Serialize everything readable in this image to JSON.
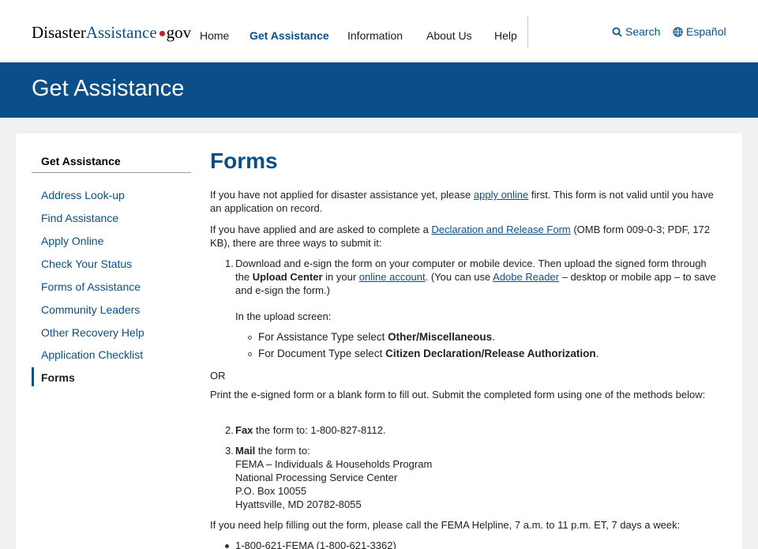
{
  "header": {
    "logo": {
      "part1": "Disaster",
      "part2": "Assistance",
      "part3": "gov"
    },
    "nav": [
      "Home",
      "Get Assistance",
      "Information",
      "About Us",
      "Help"
    ],
    "active_nav": "Get Assistance",
    "search_label": "Search",
    "language_label": "Español"
  },
  "banner": {
    "title": "Get Assistance"
  },
  "sidebar": {
    "heading": "Get Assistance",
    "items": [
      "Address Look-up",
      "Find Assistance",
      "Apply Online",
      "Check Your Status",
      "Forms of Assistance",
      "Community Leaders",
      "Other Recovery Help",
      "Application Checklist",
      "Forms"
    ],
    "current": "Forms"
  },
  "main": {
    "title": "Forms",
    "p1": {
      "before": "If you have not applied for disaster assistance yet, please ",
      "link": "apply online",
      "after": " first. This form is not valid until you have an application on record."
    },
    "p2": {
      "before": "If you have applied and are asked to complete a ",
      "link": "Declaration and Release Form",
      "after": " (OMB form 009-0-3; PDF, 172 KB), there are three ways to submit it:"
    },
    "step1": {
      "num": "1.",
      "t1": "Download and e-sign the form on your computer or mobile device. Then upload the signed form through the ",
      "b1": "Upload Center",
      "t2": " in your ",
      "link1": "online account",
      "t3": ". (You can use ",
      "link2": "Adobe Reader",
      "t4": " – desktop or mobile app – to save and e-sign the form.)",
      "upload_intro": "In the upload screen:",
      "sub1_pre": "For Assistance Type select ",
      "sub1_bold": "Other/Miscellaneous",
      "sub1_post": ".",
      "sub2_pre": "For Document Type select ",
      "sub2_bold": "Citizen Declaration/Release Authorization",
      "sub2_post": "."
    },
    "or": "OR",
    "p3": "Print the e-signed form or a blank form to fill out. Submit the completed form using one of the methods below:",
    "step2": {
      "num": "2.",
      "bold": "Fax",
      "text": " the form to: 1-800-827-8112."
    },
    "step3": {
      "num": "3.",
      "bold": "Mail",
      "text": " the form to:",
      "address": [
        "FEMA – Individuals & Households Program",
        "National Processing Service Center",
        "P.O. Box 10055",
        "Hyattsville, MD 20782-8055"
      ]
    },
    "help": "If you need help filling out the form, please call the FEMA Helpline, 7 a.m. to 11 p.m. ET, 7 days a week:",
    "phones": [
      "1-800-621-FEMA (1-800-621-3362)"
    ]
  }
}
